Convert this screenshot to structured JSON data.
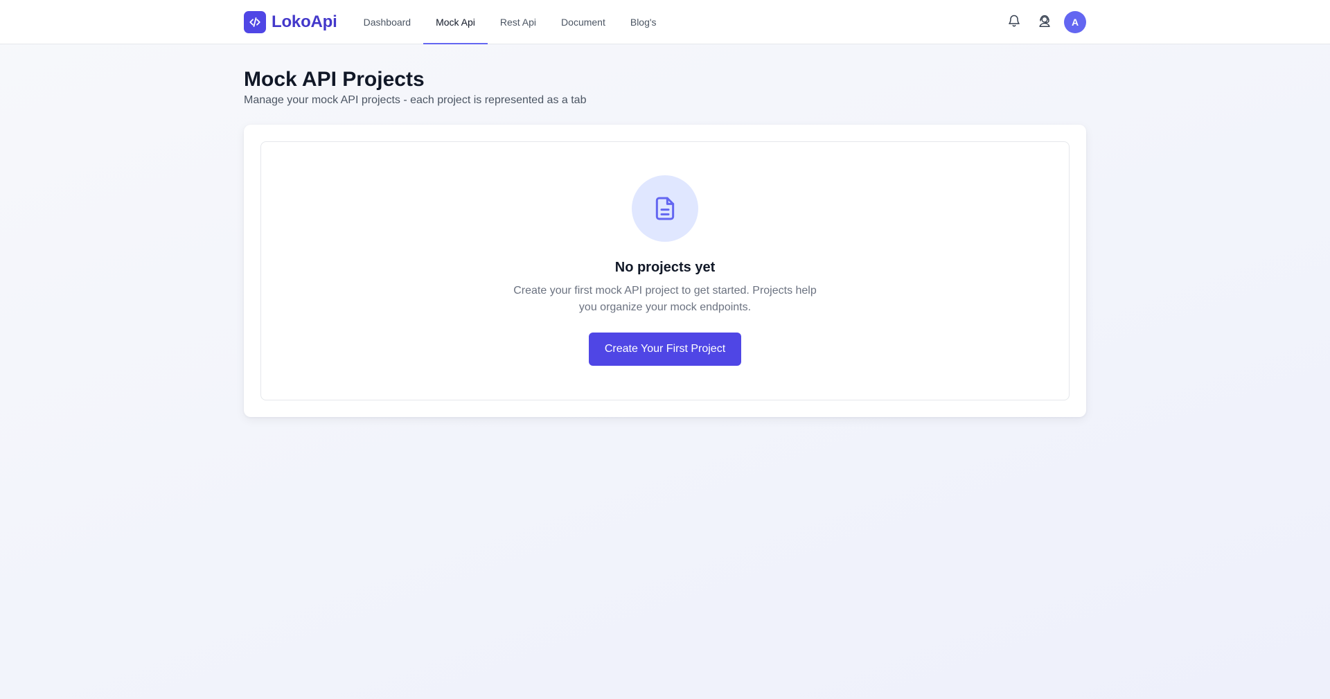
{
  "brand": {
    "name": "LokoApi",
    "logo_icon": "code-icon",
    "color": "#4f46e5"
  },
  "nav": {
    "items": [
      {
        "label": "Dashboard",
        "active": false
      },
      {
        "label": "Mock Api",
        "active": true
      },
      {
        "label": "Rest Api",
        "active": false
      },
      {
        "label": "Document",
        "active": false
      },
      {
        "label": "Blog's",
        "active": false
      }
    ]
  },
  "header_actions": {
    "notifications_icon": "bell-icon",
    "support_icon": "support-agent-icon",
    "avatar_initial": "A"
  },
  "page": {
    "title": "Mock API Projects",
    "subtitle": "Manage your mock API projects - each project is represented as a tab"
  },
  "empty_state": {
    "icon": "document-icon",
    "title": "No projects yet",
    "text": "Create your first mock API project to get started. Projects help you organize your mock endpoints.",
    "button_label": "Create Your First Project"
  },
  "colors": {
    "accent": "#4f46e5",
    "accent_light": "#e0e7ff",
    "nav_underline": "#6366f1"
  }
}
